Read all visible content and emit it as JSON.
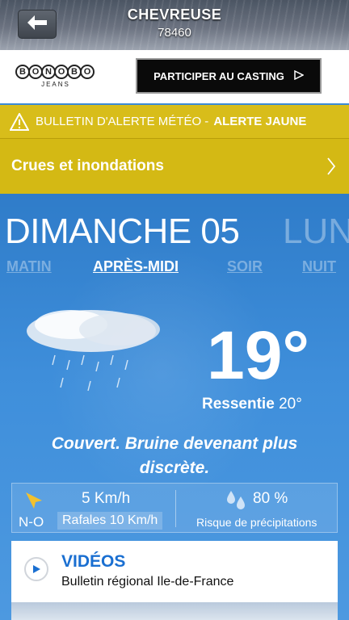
{
  "header": {
    "city": "CHEVREUSE",
    "zip": "78460"
  },
  "ad": {
    "brand_letters": [
      "B",
      "O",
      "N",
      "O",
      "B",
      "O"
    ],
    "brand_sub": "JEANS",
    "cta_label": "PARTICIPER AU CASTING"
  },
  "alert": {
    "bulletin_label": "BULLETIN D'ALERTE MÉTÉO -",
    "level_label": "ALERTE JAUNE",
    "detail": "Crues et inondations"
  },
  "forecast": {
    "day": "DIMANCHE 05",
    "next_day": "LUN",
    "periods": [
      "MATIN",
      "APRÈS-MIDI",
      "SOIR",
      "NUIT"
    ],
    "active_period": "APRÈS-MIDI",
    "temperature": "19°",
    "feels_like_label": "Ressentie",
    "feels_like_value": "20°",
    "description": "Couvert. Bruine devenant plus discrète.",
    "wind_dir": "N-O",
    "wind_speed": "5 Km/h",
    "gusts": "Rafales 10 Km/h",
    "precip_prob": "80 %",
    "precip_label": "Risque de précipitations"
  },
  "videos": {
    "title": "VIDÉOS",
    "subtitle": "Bulletin régional Ile-de-France"
  },
  "colors": {
    "alert_yellow": "#d4b914",
    "sky_blue": "#3b8ad6",
    "video_title": "#1a6fd1"
  }
}
